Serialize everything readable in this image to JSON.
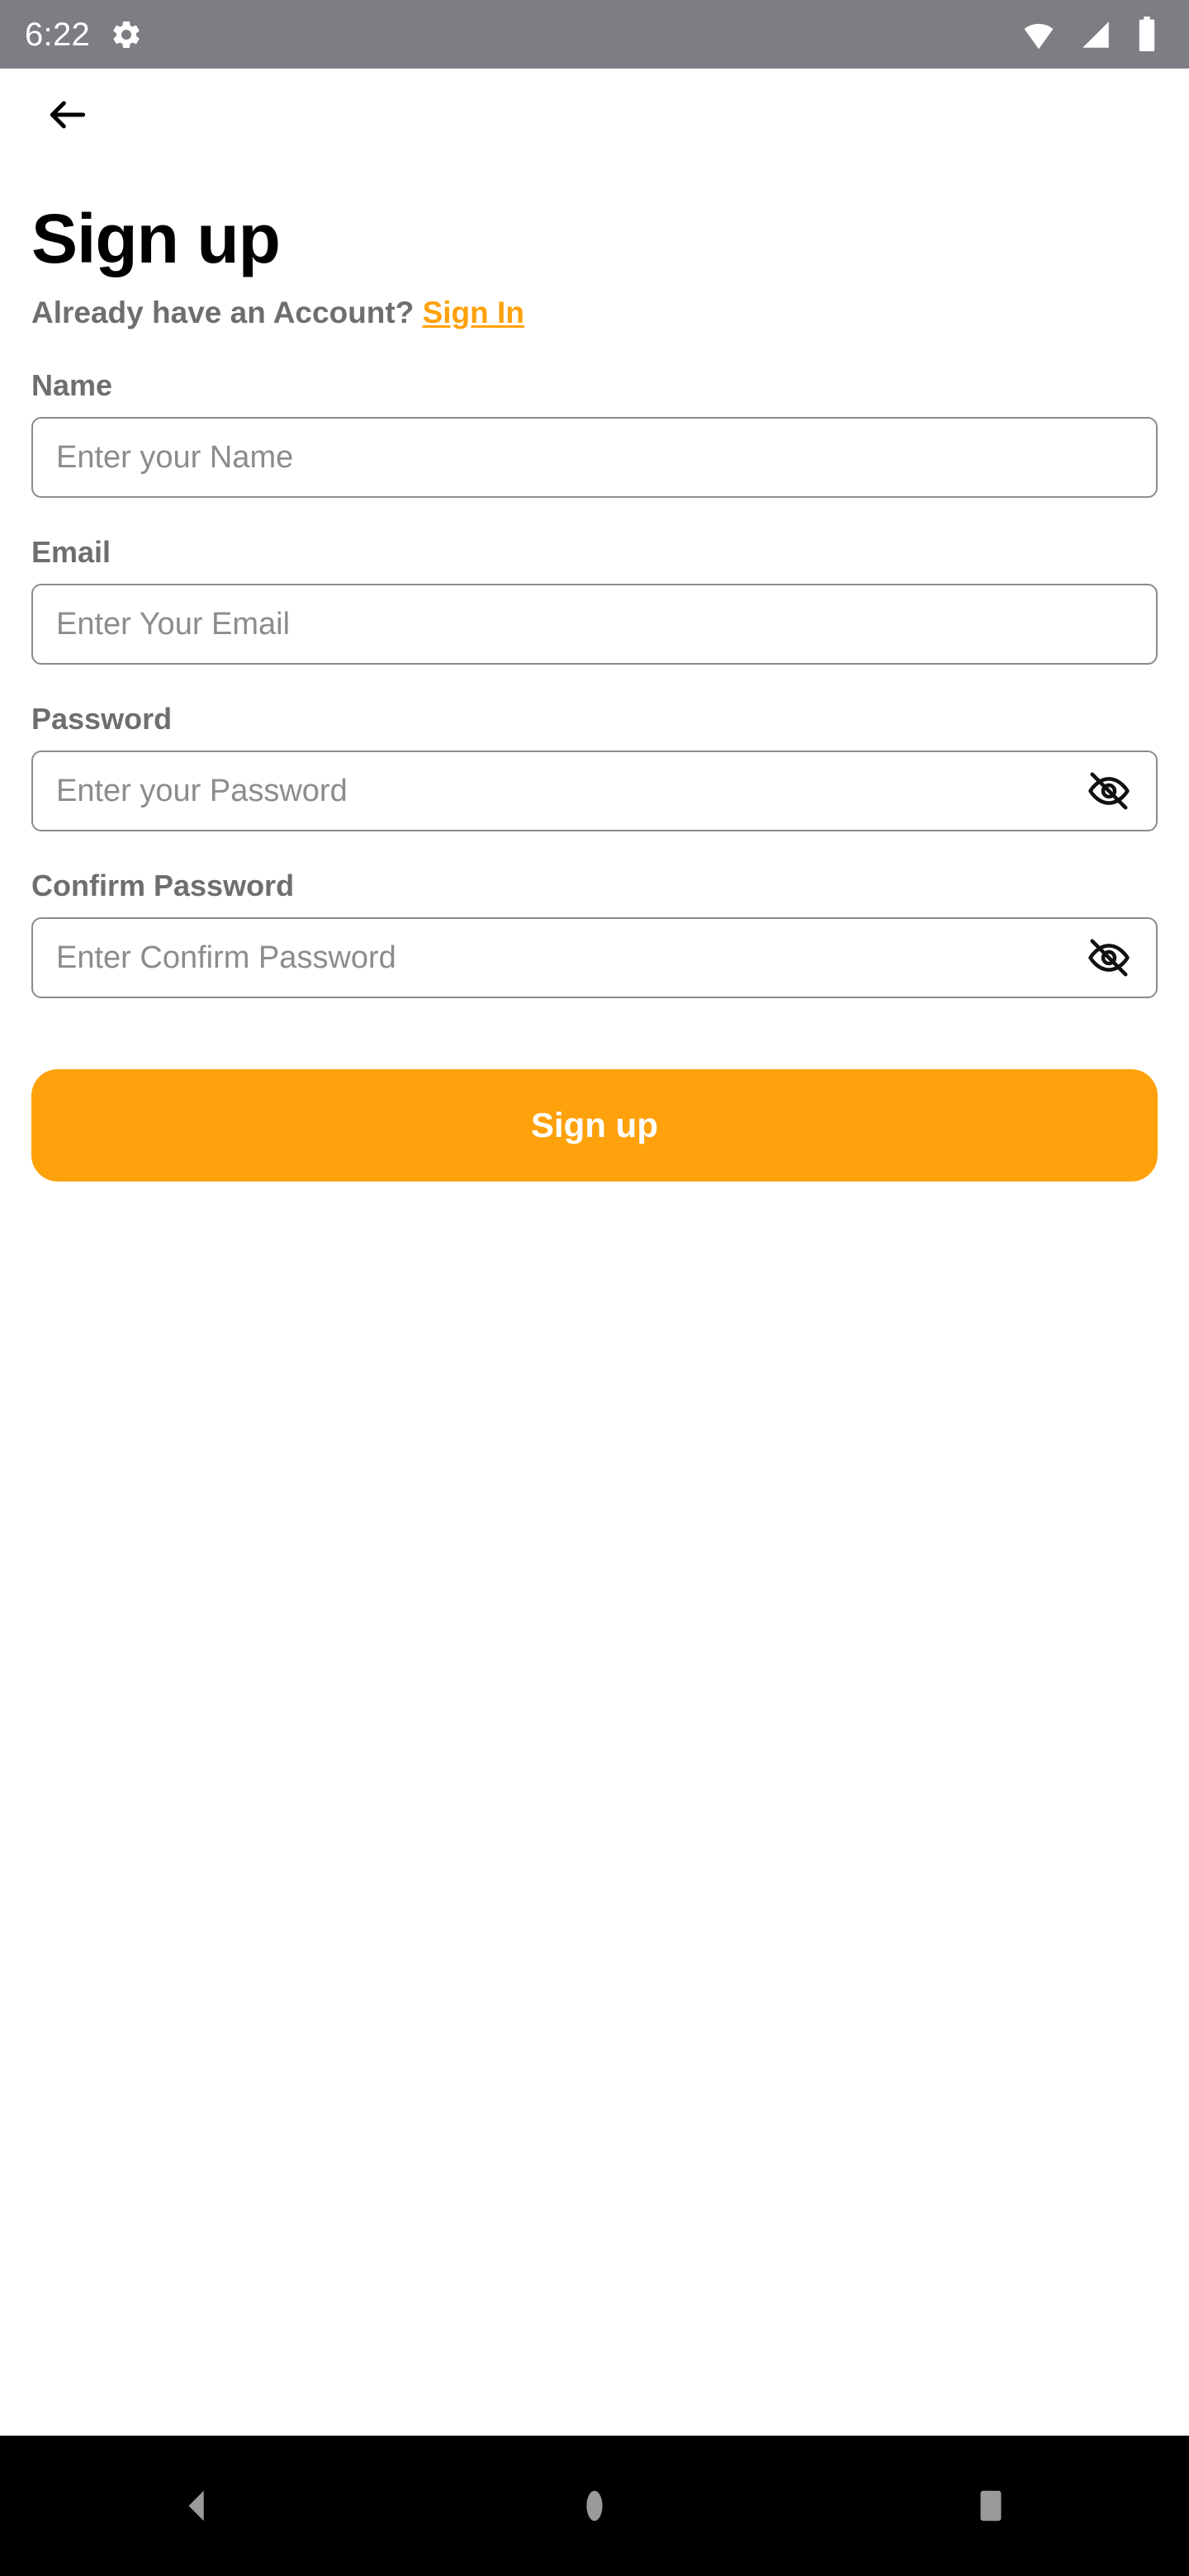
{
  "status_bar": {
    "time": "6:22",
    "icons": {
      "settings": "gear-icon",
      "wifi": "wifi-icon",
      "cellular": "cellular-signal-icon",
      "battery": "battery-icon"
    },
    "background_color": "#7d7e83",
    "foreground_color": "#ffffff"
  },
  "appbar": {
    "back_icon": "arrow-left-icon"
  },
  "page": {
    "title": "Sign up",
    "subline_prefix": "Already have an Account? ",
    "signin_label": "Sign In",
    "accent_color": "#ffa10a"
  },
  "form": {
    "fields": [
      {
        "label": "Name",
        "placeholder": "Enter your Name",
        "value": "",
        "type": "text",
        "has_toggle": false
      },
      {
        "label": "Email",
        "placeholder": "Enter Your Email",
        "value": "",
        "type": "email",
        "has_toggle": false
      },
      {
        "label": "Password",
        "placeholder": "Enter your Password",
        "value": "",
        "type": "password",
        "has_toggle": true,
        "toggle_icon": "eye-off-icon"
      },
      {
        "label": "Confirm Password",
        "placeholder": "Enter Confirm Password",
        "value": "",
        "type": "password",
        "has_toggle": true,
        "toggle_icon": "eye-off-icon"
      }
    ],
    "submit_label": "Sign up"
  },
  "nav_bar": {
    "back": "nav-back-icon",
    "home": "nav-home-icon",
    "recents": "nav-recents-icon",
    "background_color": "#000000",
    "glyph_color": "#9a9a9a"
  }
}
